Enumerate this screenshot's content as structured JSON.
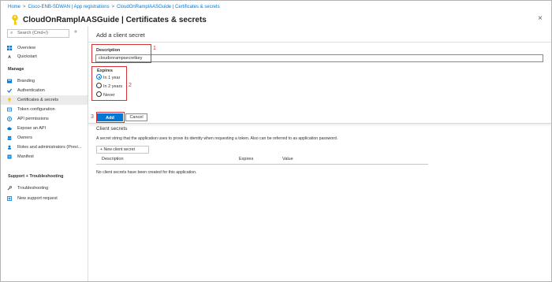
{
  "breadcrumb": {
    "items": [
      "Home",
      "Cisco-ENB-SDWAN | App registrations",
      "CloudOnRamplAASGuide | Certificates & secrets"
    ]
  },
  "header": {
    "title": "CloudOnRamplAASGuide | Certificates & secrets",
    "icon": "key-icon",
    "close": "×"
  },
  "sidebar": {
    "search_placeholder": "Search (Cmd+/)",
    "collapse": "«",
    "top_items": [
      {
        "label": "Overview",
        "icon": "grid-icon"
      },
      {
        "label": "Quickstart",
        "icon": "rocket-icon"
      }
    ],
    "manage_header": "Manage",
    "manage_items": [
      {
        "label": "Branding",
        "icon": "branding-icon"
      },
      {
        "label": "Authentication",
        "icon": "auth-icon"
      },
      {
        "label": "Certificates & secrets",
        "icon": "key-icon",
        "active": true
      },
      {
        "label": "Token configuration",
        "icon": "token-icon"
      },
      {
        "label": "API permissions",
        "icon": "permissions-icon"
      },
      {
        "label": "Expose an API",
        "icon": "cloud-icon"
      },
      {
        "label": "Owners",
        "icon": "owners-icon"
      },
      {
        "label": "Roles and administrators (Previ...",
        "icon": "roles-icon"
      },
      {
        "label": "Manifest",
        "icon": "manifest-icon"
      }
    ],
    "support_header": "Support + Troubleshooting",
    "support_items": [
      {
        "label": "Troubleshooting",
        "icon": "wrench-icon"
      },
      {
        "label": "New support request",
        "icon": "support-icon"
      }
    ]
  },
  "dialog": {
    "title": "Add a client secret",
    "description_label": "Description",
    "description_value": "cloudonrampsecretkey",
    "expires_label": "Expires",
    "options": [
      "In 1 year",
      "In 2 years",
      "Never"
    ],
    "selected_option": "In 1 year",
    "add_label": "Add",
    "cancel_label": "Cancel"
  },
  "client_secrets": {
    "heading": "Client secrets",
    "description": "A secret string that the application uses to prove its identity when requesting a token. Also can be referred to as application password.",
    "new_button": "+ New client secret",
    "columns": [
      "Description",
      "Expires",
      "Value"
    ],
    "empty_message": "No client secrets have been created for this application."
  },
  "annotations": {
    "steps": [
      "1",
      "2",
      "3"
    ],
    "color": "#d13438"
  },
  "colors": {
    "accent": "#0078d4",
    "highlight": "#d13438"
  }
}
